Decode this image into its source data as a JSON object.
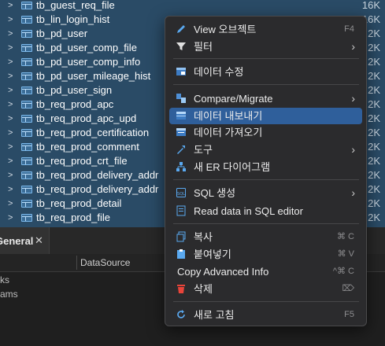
{
  "tree": {
    "rows": [
      {
        "name": "tb_guest_req_file",
        "size": "16K"
      },
      {
        "name": "tb_lin_login_hist",
        "size": "16K"
      },
      {
        "name": "tb_pd_user",
        "size": "2K"
      },
      {
        "name": "tb_pd_user_comp_file",
        "size": "2K"
      },
      {
        "name": "tb_pd_user_comp_info",
        "size": "2K"
      },
      {
        "name": "tb_pd_user_mileage_hist",
        "size": "2K"
      },
      {
        "name": "tb_pd_user_sign",
        "size": "2K"
      },
      {
        "name": "tb_req_prod_apc",
        "size": "2K"
      },
      {
        "name": "tb_req_prod_apc_upd",
        "size": "2K"
      },
      {
        "name": "tb_req_prod_certification",
        "size": "2K"
      },
      {
        "name": "tb_req_prod_comment",
        "size": "2K"
      },
      {
        "name": "tb_req_prod_crt_file",
        "size": "2K"
      },
      {
        "name": "tb_req_prod_delivery_addr",
        "size": "2K"
      },
      {
        "name": "tb_req_prod_delivery_addr",
        "size": "2K"
      },
      {
        "name": "tb_req_prod_detail",
        "size": "2K"
      },
      {
        "name": "tb_req_prod_file",
        "size": "2K"
      }
    ]
  },
  "bottom": {
    "tab_label": "General",
    "tab_close": "✕",
    "column_header": "DataSource",
    "prop_rows": [
      "rks",
      "rams"
    ]
  },
  "menu": {
    "items": [
      {
        "label": "View 오브젝트",
        "shortcut": "F4",
        "icon": "edit-pencil-icon"
      },
      {
        "label": "필터",
        "submenu": true,
        "icon": "filter-icon"
      },
      {
        "label": "데이터 수정",
        "icon": "table-edit-icon"
      },
      {
        "label": "Compare/Migrate",
        "submenu": true,
        "icon": "compare-icon"
      },
      {
        "label": "데이터 내보내기",
        "highlighted": true,
        "icon": "export-icon"
      },
      {
        "label": "데이터 가져오기",
        "icon": "import-icon"
      },
      {
        "label": "도구",
        "submenu": true,
        "icon": "tools-icon"
      },
      {
        "label": "새 ER 다이어그램",
        "icon": "er-diagram-icon"
      },
      {
        "label": "SQL 생성",
        "submenu": true,
        "icon": "sql-icon"
      },
      {
        "label": "Read data in SQL editor",
        "icon": "sql-editor-icon"
      },
      {
        "label": "복사",
        "shortcut": "⌘ C",
        "icon": "copy-icon"
      },
      {
        "label": "붙여넣기",
        "shortcut": "⌘ V",
        "icon": "paste-icon"
      },
      {
        "label": "Copy Advanced Info",
        "shortcut": "^⌘ C",
        "icon": ""
      },
      {
        "label": "삭제",
        "shortcut": "⌦",
        "icon": "delete-icon"
      },
      {
        "label": "새로 고침",
        "shortcut": "F5",
        "icon": "refresh-icon"
      }
    ],
    "submenu_glyph": "›"
  },
  "colors": {
    "tree_background": "#2a4b66",
    "menu_background": "#2b2b2d",
    "menu_highlight": "#2f5f9b"
  }
}
